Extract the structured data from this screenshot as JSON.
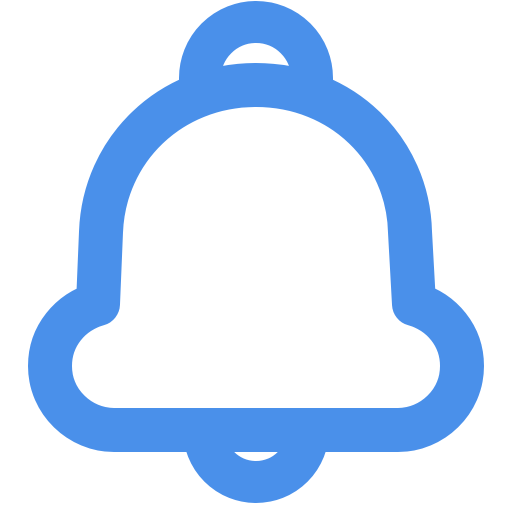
{
  "icon": {
    "name": "bell-icon",
    "stroke_color": "#4A90EA",
    "fill_color": "#FFFFFF",
    "style": "outline"
  }
}
